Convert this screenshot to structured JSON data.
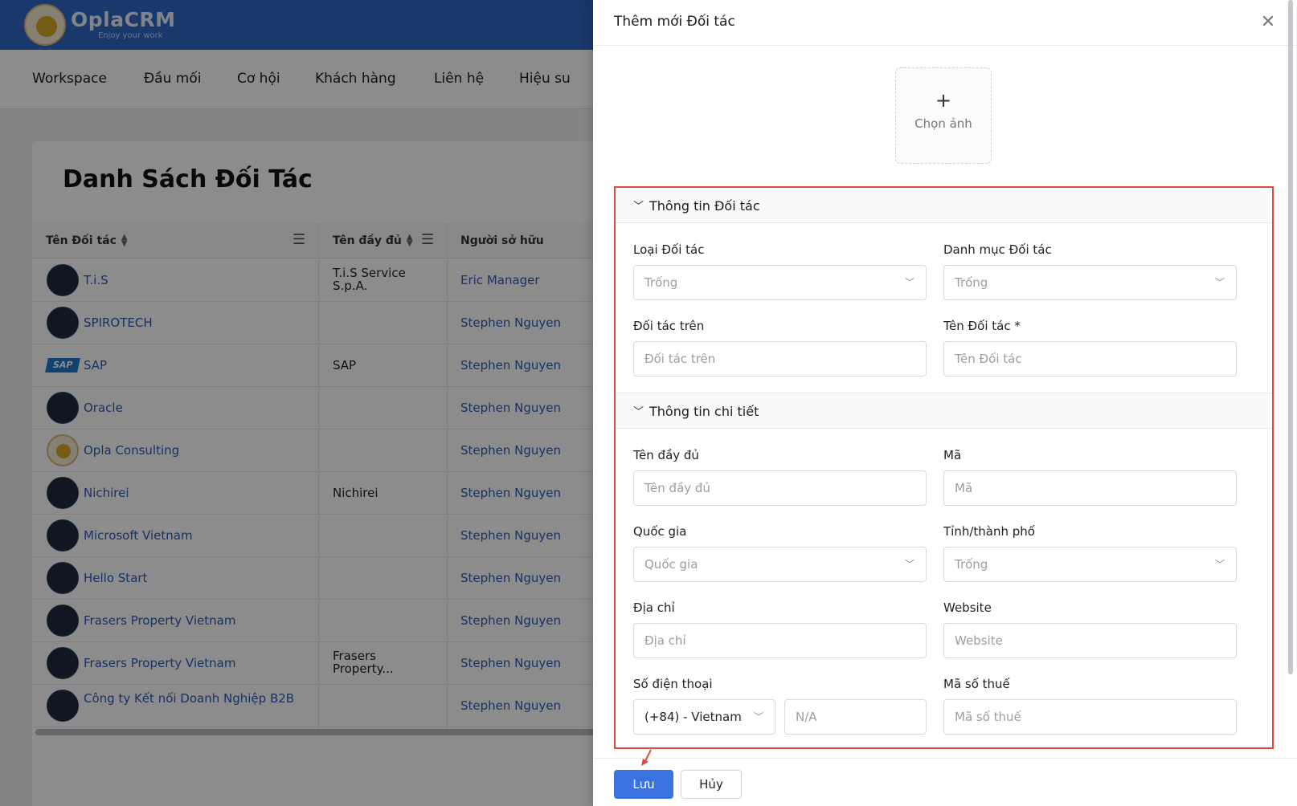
{
  "app": {
    "name": "OplaCRM",
    "tagline": "Enjoy your work"
  },
  "nav": [
    "Workspace",
    "Đầu mối",
    "Cơ hội",
    "Khách hàng",
    "Liên hệ",
    "Hiệu su"
  ],
  "list": {
    "title": "Danh Sách Đối Tác",
    "columns": {
      "name": "Tên Đối tác",
      "full_name": "Tên đầy đủ",
      "owner": "Người sở hữu"
    },
    "rows": [
      {
        "name": "T.i.S",
        "full_name": "T.i.S Service S.p.A.",
        "owner": "Eric Manager"
      },
      {
        "name": "SPIROTECH",
        "full_name": "",
        "owner": "Stephen Nguyen"
      },
      {
        "name": "SAP",
        "full_name": "SAP",
        "owner": "Stephen Nguyen"
      },
      {
        "name": "Oracle",
        "full_name": "",
        "owner": "Stephen Nguyen"
      },
      {
        "name": "Opla Consulting",
        "full_name": "",
        "owner": "Stephen Nguyen"
      },
      {
        "name": "Nichirei",
        "full_name": "Nichirei",
        "owner": "Stephen Nguyen"
      },
      {
        "name": "Microsoft Vietnam",
        "full_name": "",
        "owner": "Stephen Nguyen"
      },
      {
        "name": "Hello Start",
        "full_name": "",
        "owner": "Stephen Nguyen"
      },
      {
        "name": "Frasers Property Vietnam",
        "full_name": "",
        "owner": "Stephen Nguyen"
      },
      {
        "name": "Frasers Property Vietnam",
        "full_name": "Frasers Property...",
        "owner": "Stephen Nguyen"
      },
      {
        "name": "Công ty Kết nối Doanh Nghiệp B2B",
        "full_name": "",
        "owner": "Stephen Nguyen"
      }
    ]
  },
  "drawer": {
    "title": "Thêm mới Đối tác",
    "upload_label": "Chọn ảnh",
    "section1": {
      "title": "Thông tin Đối tác",
      "partner_type": {
        "label": "Loại Đối tác",
        "value": "Trống"
      },
      "partner_category": {
        "label": "Danh mục Đối tác",
        "value": "Trống"
      },
      "parent_partner": {
        "label": "Đối tác trên",
        "placeholder": "Đối tác trên"
      },
      "partner_name": {
        "label": "Tên Đối tác *",
        "placeholder": "Tên Đối tác"
      }
    },
    "section2": {
      "title": "Thông tin chi tiết",
      "full_name": {
        "label": "Tên đầy đủ",
        "placeholder": "Tên đầy đủ"
      },
      "code": {
        "label": "Mã",
        "placeholder": "Mã"
      },
      "country": {
        "label": "Quốc gia",
        "placeholder": "Quốc gia"
      },
      "city": {
        "label": "Tỉnh/thành phố",
        "value": "Trống"
      },
      "address": {
        "label": "Địa chỉ",
        "placeholder": "Địa chỉ"
      },
      "website": {
        "label": "Website",
        "placeholder": "Website"
      },
      "phone": {
        "label": "Số điện thoại",
        "country_code": "(+84) - Vietnam",
        "placeholder": "N/A"
      },
      "tax_code": {
        "label": "Mã số thuế",
        "placeholder": "Mã số thuế"
      }
    },
    "save_label": "Lưu",
    "cancel_label": "Hủy"
  },
  "colors": {
    "brand": "#2f66c4",
    "primary": "#3a73e0",
    "highlight": "#e2473f",
    "link": "#2e5bb2"
  }
}
